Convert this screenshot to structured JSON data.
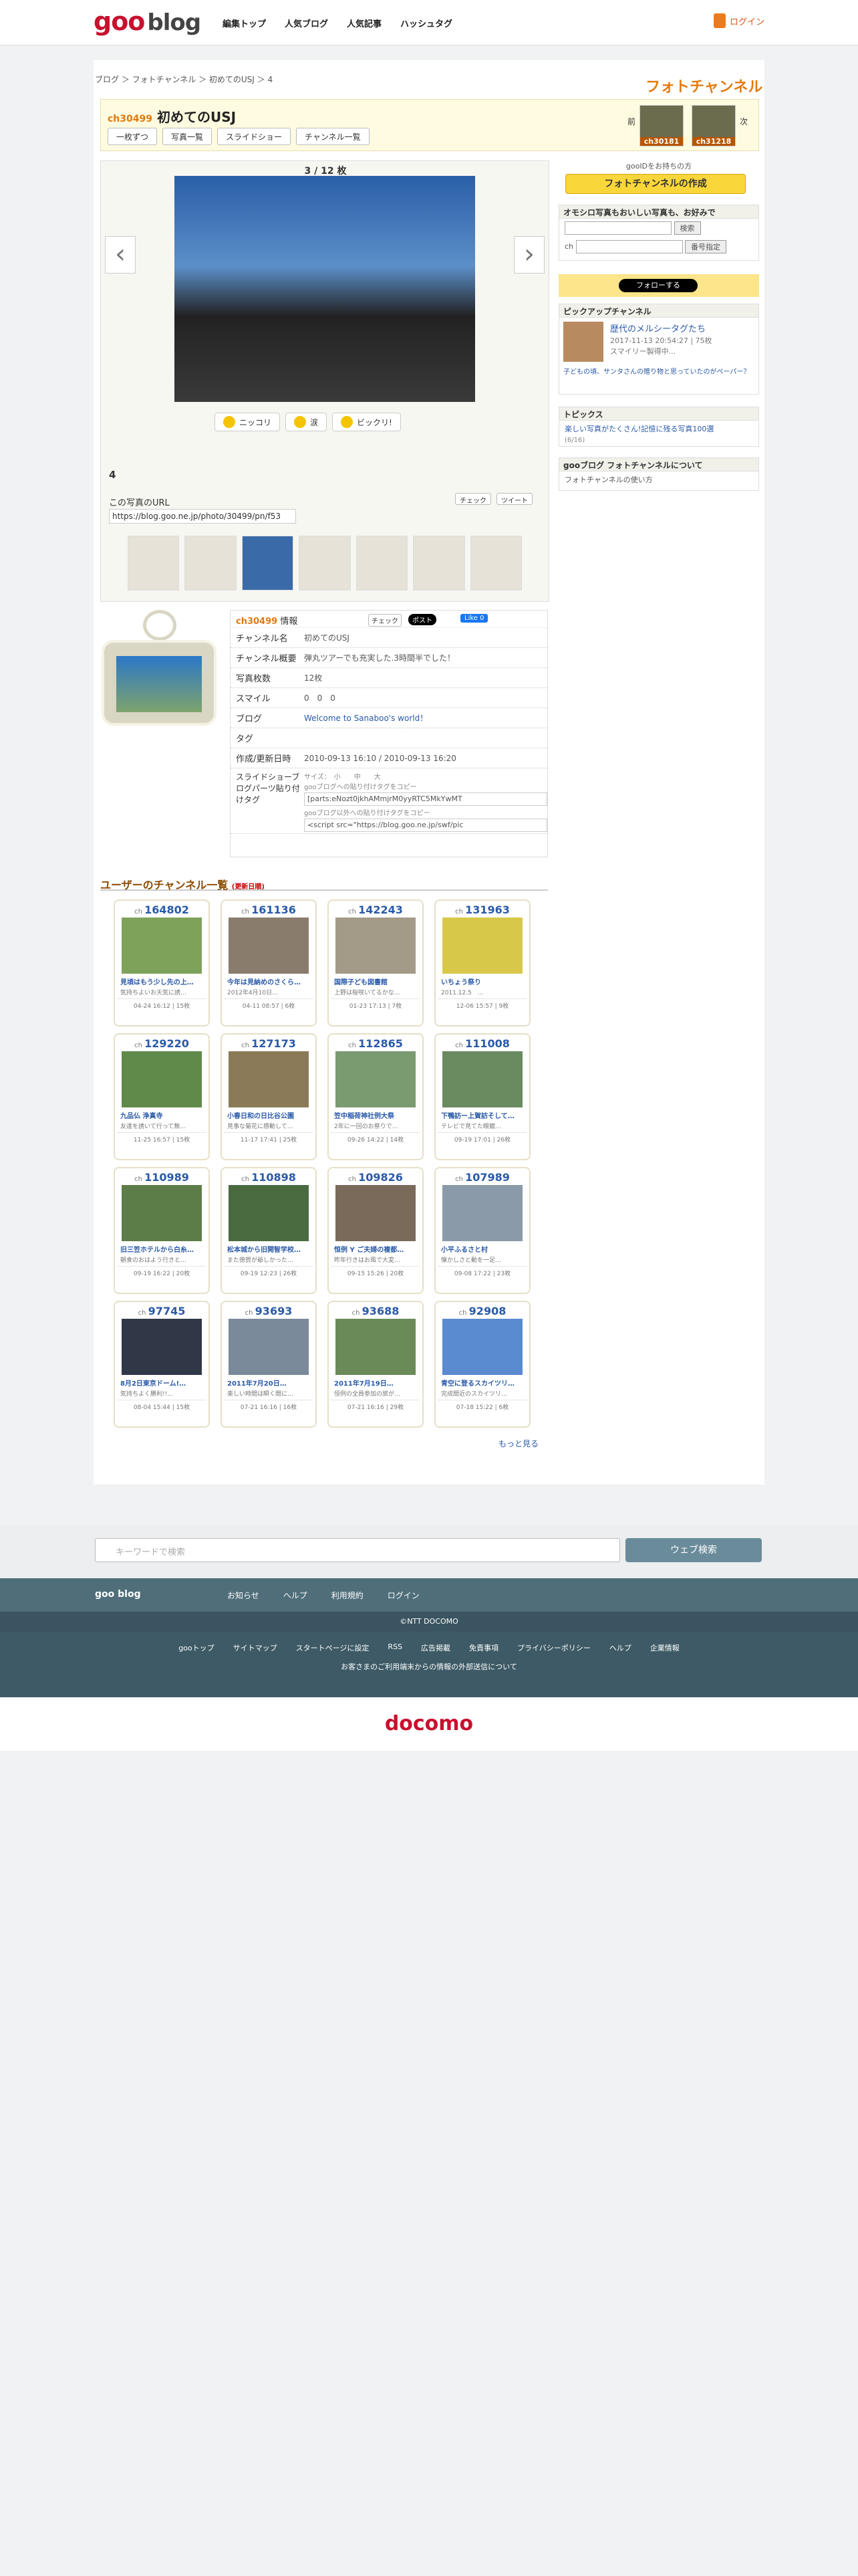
{
  "header": {
    "logo_goo": "goo",
    "logo_blog": "blog",
    "nav": [
      "編集トップ",
      "人気ブログ",
      "人気記事",
      "ハッシュタグ"
    ],
    "login": "ログイン"
  },
  "breadcrumb": "ブログ ＞ フォトチャンネル ＞ 初めてのUSJ ＞ 4",
  "photochannel_logo": "フォトチャンネル",
  "channel": {
    "id": "ch30499",
    "title": "初めてのUSJ",
    "buttons": [
      "一枚ずつ",
      "写真一覧",
      "スライドショー",
      "チャンネル一覧"
    ],
    "prev": "前",
    "next": "次",
    "prev_id": "ch30181",
    "next_id": "ch31218"
  },
  "viewer": {
    "count": "3 / 12 枚",
    "reactions": [
      "ニッコリ",
      "涙",
      "ビックリ!"
    ],
    "caption": "4",
    "url_label": "この写真のURL",
    "url": "https://blog.goo.ne.jp/photo/30499/pn/f53",
    "share_check": "チェック",
    "share_tweet": "ツイート"
  },
  "side": {
    "goo_prompt": "gooIDをお持ちの方",
    "create": "フォトチャンネルの作成",
    "search_head": "オモシロ写真もおいしい写真も、お好みで",
    "search_btn": "検索",
    "ch_label": "ch",
    "number_btn": "番号指定",
    "follow": "フォローする",
    "pickup_head": "ピックアップチャンネル",
    "pickup_title": "歴代のメルシータグたち",
    "pickup_meta": "2017-11-13 20:54:27 | 75枚",
    "pickup_desc": "スマイリー製得中...",
    "pickup_text": "子どもの頃、サンタさんの贈り物と思っていたのがペーパー？",
    "topics_head": "トピックス",
    "topics_item": "楽しい写真がたくさん!記憶に残る写真100選",
    "topics_sub": "(6/16)",
    "about_head": "gooブログ フォトチャンネルについて",
    "about_item": "フォトチャンネルの使い方"
  },
  "info": {
    "id": "ch30499",
    "head": "情報",
    "check": "チェック",
    "post": "ポスト",
    "like": "Like 0",
    "rows": [
      [
        "チャンネル名",
        "初めてのUSJ"
      ],
      [
        "チャンネル概要",
        "弾丸ツアーでも充実した.3時間半でした！"
      ],
      [
        "写真枚数",
        "12枚"
      ],
      [
        "スマイル",
        "0　0　0"
      ],
      [
        "ブログ",
        "Welcome to Sanaboo's world！"
      ],
      [
        "タグ",
        ""
      ],
      [
        "作成/更新日時",
        "2010-09-13 16:10 / 2010-09-13 16:20"
      ]
    ],
    "parts_label": "スライドショーブログパーツ貼り付けタグ",
    "size": "サイズ：　小　　中　　大",
    "copy1": "gooブログへの貼り付けタグをコピー",
    "tag1": "[parts:eNozt0jkhAMmjrM0yyRTC5MkYwMT",
    "copy2": "gooブログ以外への貼り付けタグをコピー",
    "tag2": "<script src=\"https://blog.goo.ne.jp/swf/pic"
  },
  "user_section": "ユーザーのチャンネル一覧",
  "user_section_sub": "(更新日順)",
  "cards": [
    {
      "no": "164802",
      "t": "見頃はもう少し先の上…",
      "d": "気持ちよいお天気に誘…",
      "m": "04-24 16:12 | 15枚"
    },
    {
      "no": "161136",
      "t": "今年は見納めのさくら…",
      "d": "2012年4月10日…",
      "m": "04-11 08:57 | 6枚"
    },
    {
      "no": "142243",
      "t": "国際子ども図書館",
      "d": "上野は桜咲いてるかな…",
      "m": "01-23 17:13 | 7枚"
    },
    {
      "no": "131963",
      "t": "いちょう祭り",
      "d": "2011.12.5　…",
      "m": "12-06 15:57 | 9枚"
    },
    {
      "no": "129220",
      "t": "九品仏 浄真寺",
      "d": "友達を誘いて行って無…",
      "m": "11-25 16:57 | 15枚"
    },
    {
      "no": "127173",
      "t": "小春日和の日比谷公園",
      "d": "見事な菊花に感動して…",
      "m": "11-17 17:41 | 25枚"
    },
    {
      "no": "112865",
      "t": "笠中稲荷神社例大祭",
      "d": "2年に一回のお祭りで…",
      "m": "09-26 14:22 | 14枚"
    },
    {
      "no": "111008",
      "t": "下鴨訪ー上賀訪そして…",
      "d": "テレビで見てた眼鏡…",
      "m": "09-19 17:01 | 26枚"
    },
    {
      "no": "110989",
      "t": "旧三笠ホテルから白糸…",
      "d": "朝食のおはよう行きと…",
      "m": "09-19 16:22 | 20枚"
    },
    {
      "no": "110898",
      "t": "松本城から旧開智学校…",
      "d": "また徳賀が爺しかった…",
      "m": "09-19 12:23 | 26枚"
    },
    {
      "no": "109826",
      "t": "恒例 Y ご夫婦の複都…",
      "d": "昨年行きはお風で大変…",
      "m": "09-15 15:26 | 20枚"
    },
    {
      "no": "107989",
      "t": "小平ふるさと村",
      "d": "懐かしさと動を一足…",
      "m": "09-08 17:22 | 23枚"
    },
    {
      "no": "97745",
      "t": "8月2日東京ドーム!…",
      "d": "気持ちよく勝利!!…",
      "m": "08-04 15:44 | 15枚"
    },
    {
      "no": "93693",
      "t": "2011年7月20日…",
      "d": "楽しい時間は瞬く間に…",
      "m": "07-21 16:16 | 16枚"
    },
    {
      "no": "93688",
      "t": "2011年7月19日…",
      "d": "恒例の全員参加の旅が…",
      "m": "07-21 16:16 | 29枚"
    },
    {
      "no": "92908",
      "t": "青空に登るスカイツリ…",
      "d": "完成間近のスカイツリ…",
      "m": "07-18 15:22 | 6枚"
    }
  ],
  "more": "もっと見る",
  "search": {
    "placeholder": "キーワードで検索",
    "button": "ウェブ検索"
  },
  "footer": {
    "logo": "goo blog",
    "links1": [
      "お知らせ",
      "ヘルプ",
      "利用規約",
      "ログイン"
    ],
    "ntt": "©NTT DOCOMO",
    "links2": [
      "gooトップ",
      "サイトマップ",
      "スタートページに設定",
      "RSS",
      "広告掲載",
      "免責事項",
      "プライバシーポリシー",
      "ヘルプ",
      "企業情報"
    ],
    "notice": "お客さまのご利用端末からの情報の外部送信について"
  },
  "docomo": "docomo"
}
